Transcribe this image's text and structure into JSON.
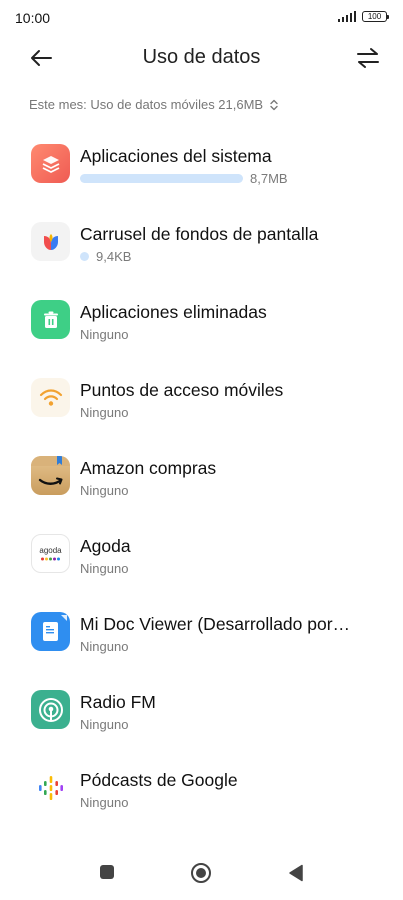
{
  "status_bar": {
    "time": "10:00",
    "battery": "100"
  },
  "header": {
    "title": "Uso de datos"
  },
  "filter": {
    "label": "Este mes: Uso de datos móviles 21,6MB"
  },
  "apps": [
    {
      "name": "Aplicaciones del sistema",
      "usage": "8,7MB",
      "icon": "system-apps-icon",
      "usage_fraction": 1.0
    },
    {
      "name": "Carrusel de fondos de pantalla",
      "usage": "9,4KB",
      "icon": "wallpaper-carousel-icon"
    },
    {
      "name": "Aplicaciones eliminadas",
      "usage": "Ninguno",
      "icon": "trash-icon"
    },
    {
      "name": "Puntos de acceso móviles",
      "usage": "Ninguno",
      "icon": "hotspot-icon"
    },
    {
      "name": "Amazon compras",
      "usage": "Ninguno",
      "icon": "amazon-icon"
    },
    {
      "name": "Agoda",
      "usage": "Ninguno",
      "icon": "agoda-icon"
    },
    {
      "name": "Mi Doc Viewer (Desarrollado por…",
      "usage": "Ninguno",
      "icon": "doc-viewer-icon"
    },
    {
      "name": "Radio FM",
      "usage": "Ninguno",
      "icon": "radio-icon"
    },
    {
      "name": "Pódcasts de Google",
      "usage": "Ninguno",
      "icon": "google-podcasts-icon"
    }
  ],
  "icon_text": {
    "agoda": "agoda"
  },
  "colors": {
    "accent_bar": "#cfe4fb",
    "system_icon": "#f26a5b",
    "trash_icon": "#3ecf86",
    "hotspot_icon": "#f2a230",
    "amazon_icon": "#d9b27a",
    "doc_icon": "#2f8ef0",
    "radio_icon": "#3bb08f"
  }
}
